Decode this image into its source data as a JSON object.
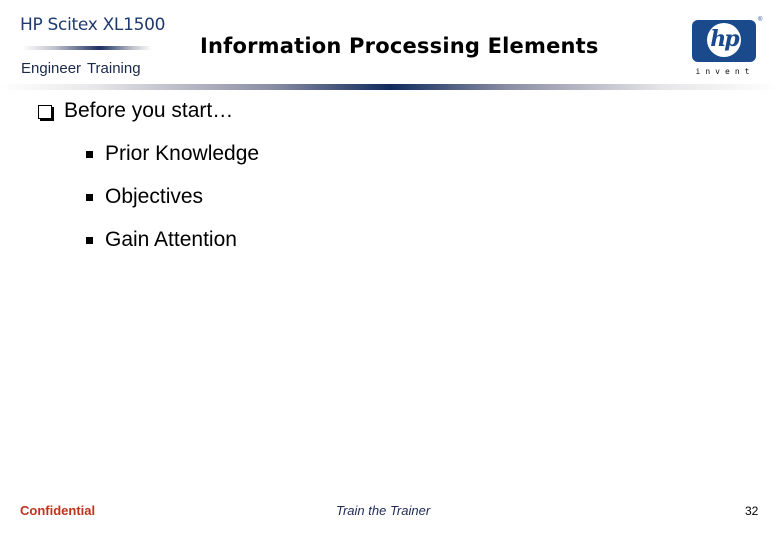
{
  "header": {
    "brand_title": "HP Scitex XL1500",
    "brand_subtitle": "Engineer  Training",
    "slide_title": "Information Processing Elements",
    "logo": {
      "icon": "hp-logo-icon",
      "text": "hp",
      "tagline": "invent",
      "brand_color": "#1b4a8c"
    }
  },
  "content": {
    "main_bullet": {
      "icon": "hollow-square-bullet",
      "text": "Before you start…"
    },
    "sub_bullets": [
      {
        "icon": "filled-square-bullet",
        "text": "Prior Knowledge"
      },
      {
        "icon": "filled-square-bullet",
        "text": "Objectives"
      },
      {
        "icon": "filled-square-bullet",
        "text": "Gain Attention"
      }
    ]
  },
  "footer": {
    "confidential": "Confidential",
    "confidential_color": "#c0321c",
    "center_text": "Train the Trainer",
    "page_number": "32"
  }
}
